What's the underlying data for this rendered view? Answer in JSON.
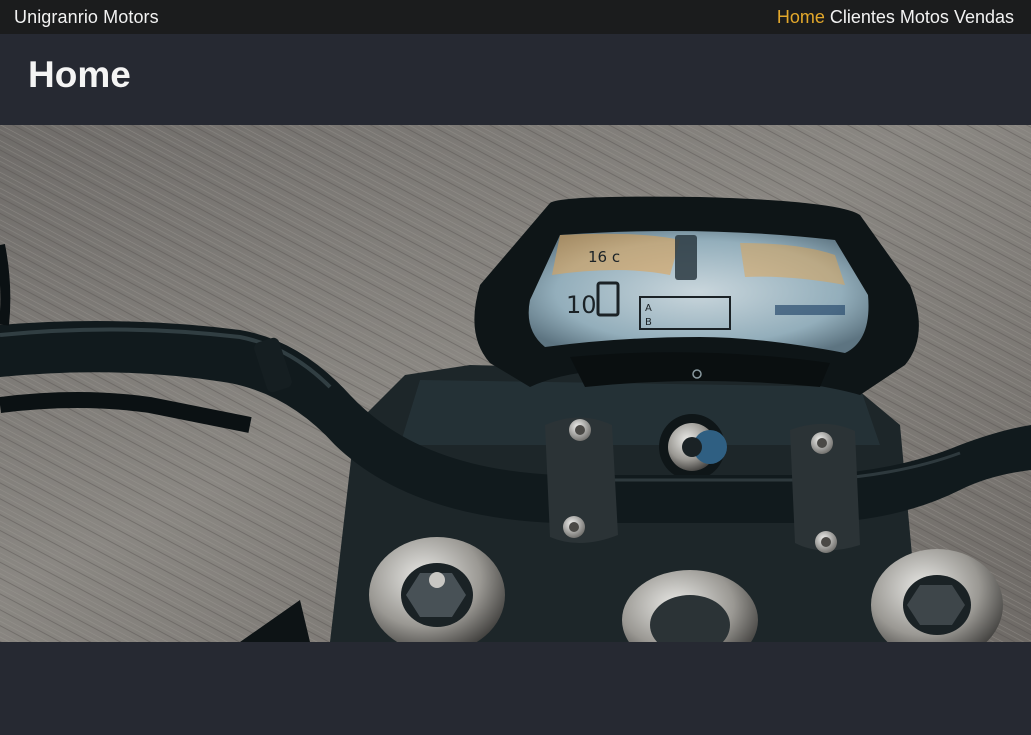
{
  "navbar": {
    "brand": "Unigranrio Motors",
    "links": [
      {
        "label": "Home",
        "active": true
      },
      {
        "label": "Clientes",
        "active": false
      },
      {
        "label": "Motos",
        "active": false
      },
      {
        "label": "Vendas",
        "active": false
      }
    ],
    "active_color": "#e3a82b"
  },
  "header": {
    "title": "Home"
  },
  "hero": {
    "image_kind": "motorcycle-handlebar-photo",
    "dashboard": {
      "temperature": "16 c",
      "speed": "10",
      "trip_a": "A",
      "trip_b": "B"
    }
  },
  "colors": {
    "navbar_bg": "#1b1c1d",
    "page_bg": "#262932",
    "text": "#f2f2f2"
  }
}
